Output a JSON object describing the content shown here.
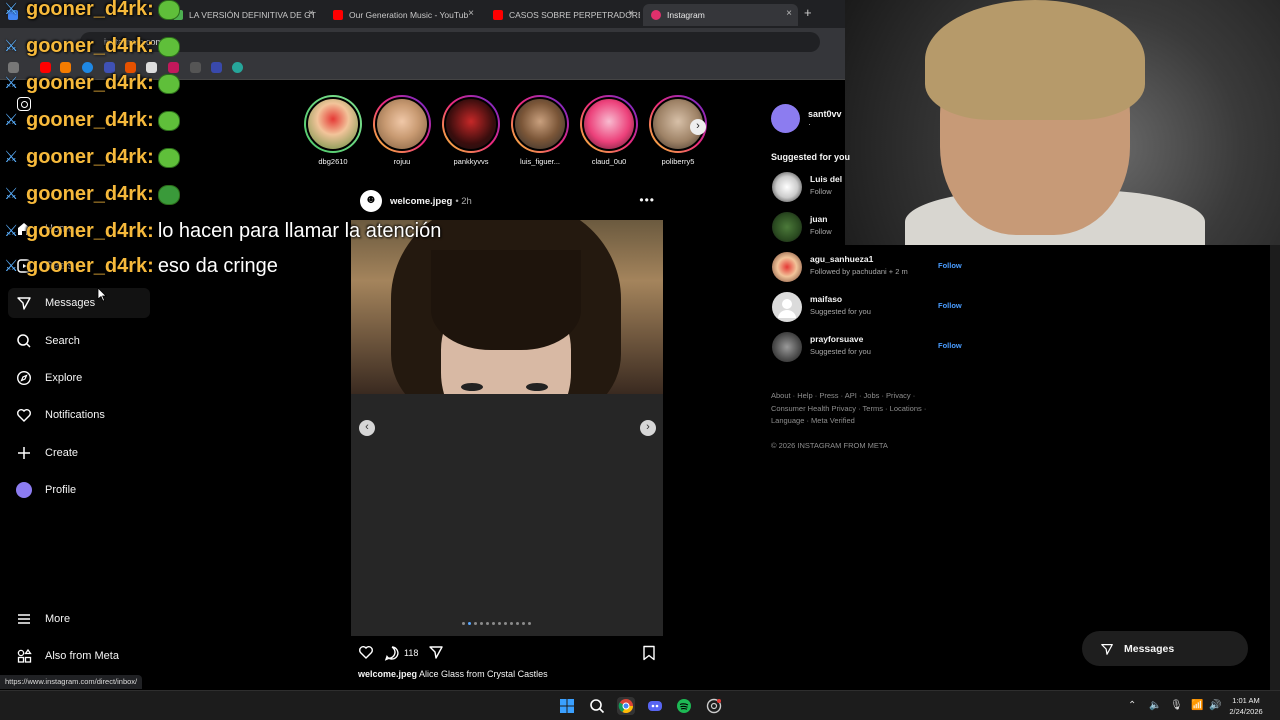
{
  "browser": {
    "tabs": [
      {
        "label": "",
        "favicon_color": "#4285f4"
      },
      {
        "label": "LA VERSIÓN DEFINITIVA DE GT",
        "favicon_color": "#4caf50"
      },
      {
        "label": "Our Generation Music - YouTub",
        "favicon_color": "#ff0000"
      },
      {
        "label": "CASOS SOBRE PERPETRADORE",
        "favicon_color": "#ff0000"
      },
      {
        "label": "Instagram",
        "favicon_color": "#e1306c"
      }
    ],
    "address": "instagram.com",
    "new_tab": "+",
    "close": "×"
  },
  "sidebar": {
    "items": [
      {
        "label": "Home",
        "icon": "home-icon"
      },
      {
        "label": "Reels",
        "icon": "reels-icon"
      },
      {
        "label": "Messages",
        "icon": "messages-icon"
      },
      {
        "label": "Search",
        "icon": "search-icon"
      },
      {
        "label": "Explore",
        "icon": "explore-icon"
      },
      {
        "label": "Notifications",
        "icon": "heart-icon"
      },
      {
        "label": "Create",
        "icon": "plus-icon"
      },
      {
        "label": "Profile",
        "icon": "avatar-icon"
      }
    ],
    "more": "More",
    "also_from_meta": "Also from Meta"
  },
  "stories": [
    {
      "name": "dbg2610",
      "seen": true
    },
    {
      "name": "rojuu",
      "seen": false
    },
    {
      "name": "pankkyvvs",
      "seen": false
    },
    {
      "name": "luis_figuer...",
      "seen": false
    },
    {
      "name": "claud_0u0",
      "seen": false
    },
    {
      "name": "poliberry5",
      "seen": false
    }
  ],
  "post": {
    "username": "welcome.jpeg",
    "time": "• 2h",
    "more": "•••",
    "comments": "118",
    "caption_user": "welcome.jpeg",
    "caption_text": "Alice Glass from Crystal Castles",
    "slide_count": 12,
    "active_slide": 2
  },
  "right": {
    "me": {
      "username": "sant0vv",
      "sub": "·"
    },
    "suggested_title": "Suggested for you",
    "suggestions": [
      {
        "username": "Luis del",
        "sub": "Follow",
        "follow": ""
      },
      {
        "username": "juan",
        "sub": "Follow",
        "follow": ""
      },
      {
        "username": "agu_sanhueza1",
        "sub": "Followed by pachudani + 2 m",
        "follow": "Follow"
      },
      {
        "username": "maifaso",
        "sub": "Suggested for you",
        "follow": "Follow"
      },
      {
        "username": "prayforsuave",
        "sub": "Suggested for you",
        "follow": "Follow"
      }
    ],
    "footer_lines": [
      "About · Help · Press · API · Jobs · Privacy ·",
      "Consumer Health Privacy · Terms · Locations ·",
      "Language · Meta Verified"
    ],
    "copyright": "© 2026 INSTAGRAM FROM META",
    "messages_pill": "Messages"
  },
  "chat": [
    {
      "user": "gooner_d4rk:",
      "msg": "",
      "emote": true
    },
    {
      "user": "gooner_d4rk:",
      "msg": "",
      "emote": true
    },
    {
      "user": "gooner_d4rk:",
      "msg": "",
      "emote": true
    },
    {
      "user": "gooner_d4rk:",
      "msg": "",
      "emote": true
    },
    {
      "user": "gooner_d4rk:",
      "msg": "",
      "emote": true
    },
    {
      "user": "gooner_d4rk:",
      "msg": "",
      "emote": true
    },
    {
      "user": "gooner_d4rk:",
      "msg": "lo hacen para llamar la atención",
      "emote": false
    },
    {
      "user": "gooner_d4rk:",
      "msg": "eso da cringe",
      "emote": false
    }
  ],
  "status_url": "https://www.instagram.com/direct/inbox/",
  "taskbar": {
    "time": "1:01 AM",
    "date": "2/24/2026"
  }
}
